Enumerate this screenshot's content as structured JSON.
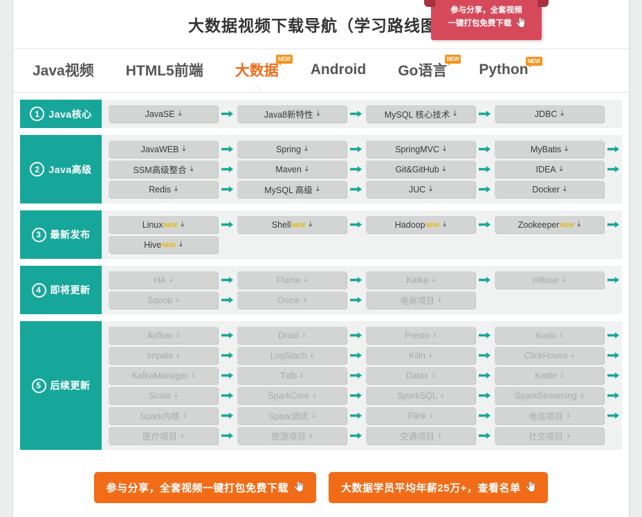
{
  "header": {
    "title": "大数据视频下载导航（学习路线图）",
    "ribbon": {
      "line1": "参与分享，全套视频",
      "line2": "一键打包免费下载",
      "cursor_icon": "hand-cursor-icon",
      "color": "#d6495b"
    }
  },
  "tabs": [
    {
      "label": "Java视频",
      "active": false,
      "badge": ""
    },
    {
      "label": "HTML5前端",
      "active": false,
      "badge": ""
    },
    {
      "label": "大数据",
      "active": true,
      "badge": "NEW"
    },
    {
      "label": "Android",
      "active": false,
      "badge": ""
    },
    {
      "label": "Go语言",
      "active": false,
      "badge": "NEW"
    },
    {
      "label": "Python",
      "active": false,
      "badge": "NEW"
    }
  ],
  "colors": {
    "accent_teal": "#17a79a",
    "accent_orange": "#f26b16",
    "tab_active": "#ef6c1b",
    "badge_orange": "#f7941d",
    "inline_new": "#e8b800",
    "pill_bg": "#d3d4d4",
    "row_bg": "#f0f1f1"
  },
  "download_glyph": "⤓",
  "stages": [
    {
      "number": "1",
      "label": "Java核心",
      "rows": [
        [
          {
            "label": "JavaSE",
            "dim": false,
            "new": false,
            "arrow_after": true
          },
          {
            "label": "Java8新特性",
            "dim": false,
            "new": false,
            "arrow_after": true
          },
          {
            "label": "MySQL 核心技术",
            "dim": false,
            "new": false,
            "arrow_after": true
          },
          {
            "label": "JDBC",
            "dim": false,
            "new": false,
            "arrow_after": false
          }
        ]
      ]
    },
    {
      "number": "2",
      "label": "Java高级",
      "rows": [
        [
          {
            "label": "JavaWEB",
            "dim": false,
            "new": false,
            "arrow_after": true
          },
          {
            "label": "Spring",
            "dim": false,
            "new": false,
            "arrow_after": true
          },
          {
            "label": "SpringMVC",
            "dim": false,
            "new": false,
            "arrow_after": true
          },
          {
            "label": "MyBatis",
            "dim": false,
            "new": false,
            "arrow_after": true
          }
        ],
        [
          {
            "label": "SSM高级整合",
            "dim": false,
            "new": false,
            "arrow_after": true
          },
          {
            "label": "Maven",
            "dim": false,
            "new": false,
            "arrow_after": true
          },
          {
            "label": "Git&GitHub",
            "dim": false,
            "new": false,
            "arrow_after": true
          },
          {
            "label": "IDEA",
            "dim": false,
            "new": false,
            "arrow_after": true
          }
        ],
        [
          {
            "label": "Redis",
            "dim": false,
            "new": false,
            "arrow_after": true
          },
          {
            "label": "MySQL 高级",
            "dim": false,
            "new": false,
            "arrow_after": true
          },
          {
            "label": "JUC",
            "dim": false,
            "new": false,
            "arrow_after": true
          },
          {
            "label": "Docker",
            "dim": false,
            "new": false,
            "arrow_after": false
          }
        ]
      ]
    },
    {
      "number": "3",
      "label": "最新发布",
      "rows": [
        [
          {
            "label": "Linux",
            "dim": false,
            "new": true,
            "arrow_after": true
          },
          {
            "label": "Shell",
            "dim": false,
            "new": true,
            "arrow_after": true
          },
          {
            "label": "Hadoop",
            "dim": false,
            "new": true,
            "arrow_after": true
          },
          {
            "label": "Zookeeper",
            "dim": false,
            "new": true,
            "arrow_after": true
          }
        ],
        [
          {
            "label": "Hive",
            "dim": false,
            "new": true,
            "arrow_after": false
          }
        ]
      ]
    },
    {
      "number": "4",
      "label": "即将更新",
      "rows": [
        [
          {
            "label": "HA",
            "dim": true,
            "new": false,
            "arrow_after": true
          },
          {
            "label": "Flume",
            "dim": true,
            "new": false,
            "arrow_after": true
          },
          {
            "label": "Kafka",
            "dim": true,
            "new": false,
            "arrow_after": true
          },
          {
            "label": "HBase",
            "dim": true,
            "new": false,
            "arrow_after": true
          }
        ],
        [
          {
            "label": "Sqoop",
            "dim": true,
            "new": false,
            "arrow_after": true
          },
          {
            "label": "Oozie",
            "dim": true,
            "new": false,
            "arrow_after": true
          },
          {
            "label": "电商项目",
            "dim": true,
            "new": false,
            "arrow_after": false
          }
        ]
      ]
    },
    {
      "number": "5",
      "label": "后续更新",
      "rows": [
        [
          {
            "label": "Airflow",
            "dim": true,
            "new": false,
            "arrow_after": true
          },
          {
            "label": "Druid",
            "dim": true,
            "new": false,
            "arrow_after": true
          },
          {
            "label": "Presto",
            "dim": true,
            "new": false,
            "arrow_after": true
          },
          {
            "label": "Kudu",
            "dim": true,
            "new": false,
            "arrow_after": true
          }
        ],
        [
          {
            "label": "Impala",
            "dim": true,
            "new": false,
            "arrow_after": true
          },
          {
            "label": "LogStach",
            "dim": true,
            "new": false,
            "arrow_after": true
          },
          {
            "label": "Kilin",
            "dim": true,
            "new": false,
            "arrow_after": true
          },
          {
            "label": "ClickHouse",
            "dim": true,
            "new": false,
            "arrow_after": true
          }
        ],
        [
          {
            "label": "KafkaManager",
            "dim": true,
            "new": false,
            "arrow_after": true
          },
          {
            "label": "Tidb",
            "dim": true,
            "new": false,
            "arrow_after": true
          },
          {
            "label": "Datax",
            "dim": true,
            "new": false,
            "arrow_after": true
          },
          {
            "label": "Kattle",
            "dim": true,
            "new": false,
            "arrow_after": true
          }
        ],
        [
          {
            "label": "Scala",
            "dim": true,
            "new": false,
            "arrow_after": true
          },
          {
            "label": "SparkCore",
            "dim": true,
            "new": false,
            "arrow_after": true
          },
          {
            "label": "SparkSQL",
            "dim": true,
            "new": false,
            "arrow_after": true
          },
          {
            "label": "SparkStreaming",
            "dim": true,
            "new": false,
            "arrow_after": true
          }
        ],
        [
          {
            "label": "Spark内核",
            "dim": true,
            "new": false,
            "arrow_after": true
          },
          {
            "label": "Spark调优",
            "dim": true,
            "new": false,
            "arrow_after": true
          },
          {
            "label": "Flink",
            "dim": true,
            "new": false,
            "arrow_after": true
          },
          {
            "label": "电信项目",
            "dim": true,
            "new": false,
            "arrow_after": true
          }
        ],
        [
          {
            "label": "医疗项目",
            "dim": true,
            "new": false,
            "arrow_after": true
          },
          {
            "label": "旅游项目",
            "dim": true,
            "new": false,
            "arrow_after": true
          },
          {
            "label": "交通项目",
            "dim": true,
            "new": false,
            "arrow_after": true
          },
          {
            "label": "社交项目",
            "dim": true,
            "new": false,
            "arrow_after": false
          }
        ]
      ]
    }
  ],
  "footer": {
    "buttons": [
      {
        "label": "参与分享，全套视频一键打包免费下载",
        "cursor_icon": "hand-cursor-icon"
      },
      {
        "label": "大数据学员平均年薪25万+，查看名单",
        "cursor_icon": "hand-cursor-icon"
      }
    ]
  }
}
